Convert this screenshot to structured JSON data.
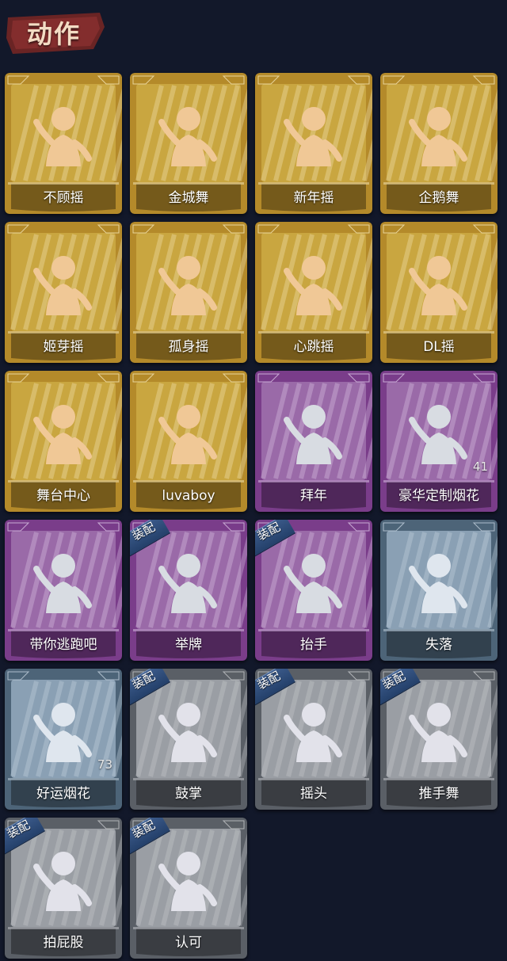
{
  "header": {
    "title": "动作"
  },
  "colors": {
    "background": "#12182a",
    "gold_frame": "#b48a2a",
    "gold_fill": "#c9a640",
    "purple_frame": "#7a3d8a",
    "purple_fill": "#9a6aa8",
    "blue_frame": "#4d6478",
    "blue_fill": "#8aa0b4",
    "gray_frame": "#5a5f66",
    "gray_fill": "#9a9ea4",
    "equip_tag": "#2f4f7f"
  },
  "actions": [
    {
      "name": "不顾摇",
      "tier": "gold",
      "icon": "dance-point-icon"
    },
    {
      "name": "金城舞",
      "tier": "gold",
      "icon": "dance-hands-icon"
    },
    {
      "name": "新年摇",
      "tier": "gold",
      "icon": "dance-clap-icon"
    },
    {
      "name": "企鹅舞",
      "tier": "gold",
      "icon": "dance-penguin-icon"
    },
    {
      "name": "姬芽摇",
      "tier": "gold",
      "icon": "dance-sway-icon"
    },
    {
      "name": "孤身摇",
      "tier": "gold",
      "icon": "dance-solo-icon"
    },
    {
      "name": "心跳摇",
      "tier": "gold",
      "icon": "dance-heartbeat-icon"
    },
    {
      "name": "DL摇",
      "tier": "gold",
      "icon": "dance-raise-arm-icon"
    },
    {
      "name": "舞台中心",
      "tier": "gold",
      "icon": "dance-center-stage-icon"
    },
    {
      "name": "luvaboy",
      "tier": "gold",
      "icon": "dance-cross-arms-icon"
    },
    {
      "name": "拜年",
      "tier": "purple",
      "icon": "bow-greeting-icon"
    },
    {
      "name": "豪华定制烟花",
      "tier": "purple",
      "icon": "fireworks-box-icon",
      "count": "41"
    },
    {
      "name": "带你逃跑吧",
      "tier": "purple",
      "icon": "dance-run-icon"
    },
    {
      "name": "举牌",
      "tier": "purple",
      "icon": "hold-sign-icon",
      "equipped": true,
      "equip_label": "装配"
    },
    {
      "name": "抬手",
      "tier": "purple",
      "icon": "raise-hand-icon",
      "equipped": true,
      "equip_label": "装配"
    },
    {
      "name": "失落",
      "tier": "blue",
      "icon": "kneel-despair-icon"
    },
    {
      "name": "好运烟花",
      "tier": "blue",
      "icon": "firework-can-icon",
      "count": "73"
    },
    {
      "name": "鼓掌",
      "tier": "gray",
      "icon": "clap-hands-icon",
      "equipped": true,
      "equip_label": "装配"
    },
    {
      "name": "摇头",
      "tier": "gray",
      "icon": "shake-head-icon",
      "equipped": true,
      "equip_label": "装配"
    },
    {
      "name": "推手舞",
      "tier": "gray",
      "icon": "push-hands-icon",
      "equipped": true,
      "equip_label": "装配"
    },
    {
      "name": "拍屁股",
      "tier": "gray",
      "icon": "pat-butt-icon",
      "equipped": true,
      "equip_label": "装配"
    },
    {
      "name": "认可",
      "tier": "gray",
      "icon": "thumbs-up-icon",
      "equipped": true,
      "equip_label": "装配"
    }
  ]
}
